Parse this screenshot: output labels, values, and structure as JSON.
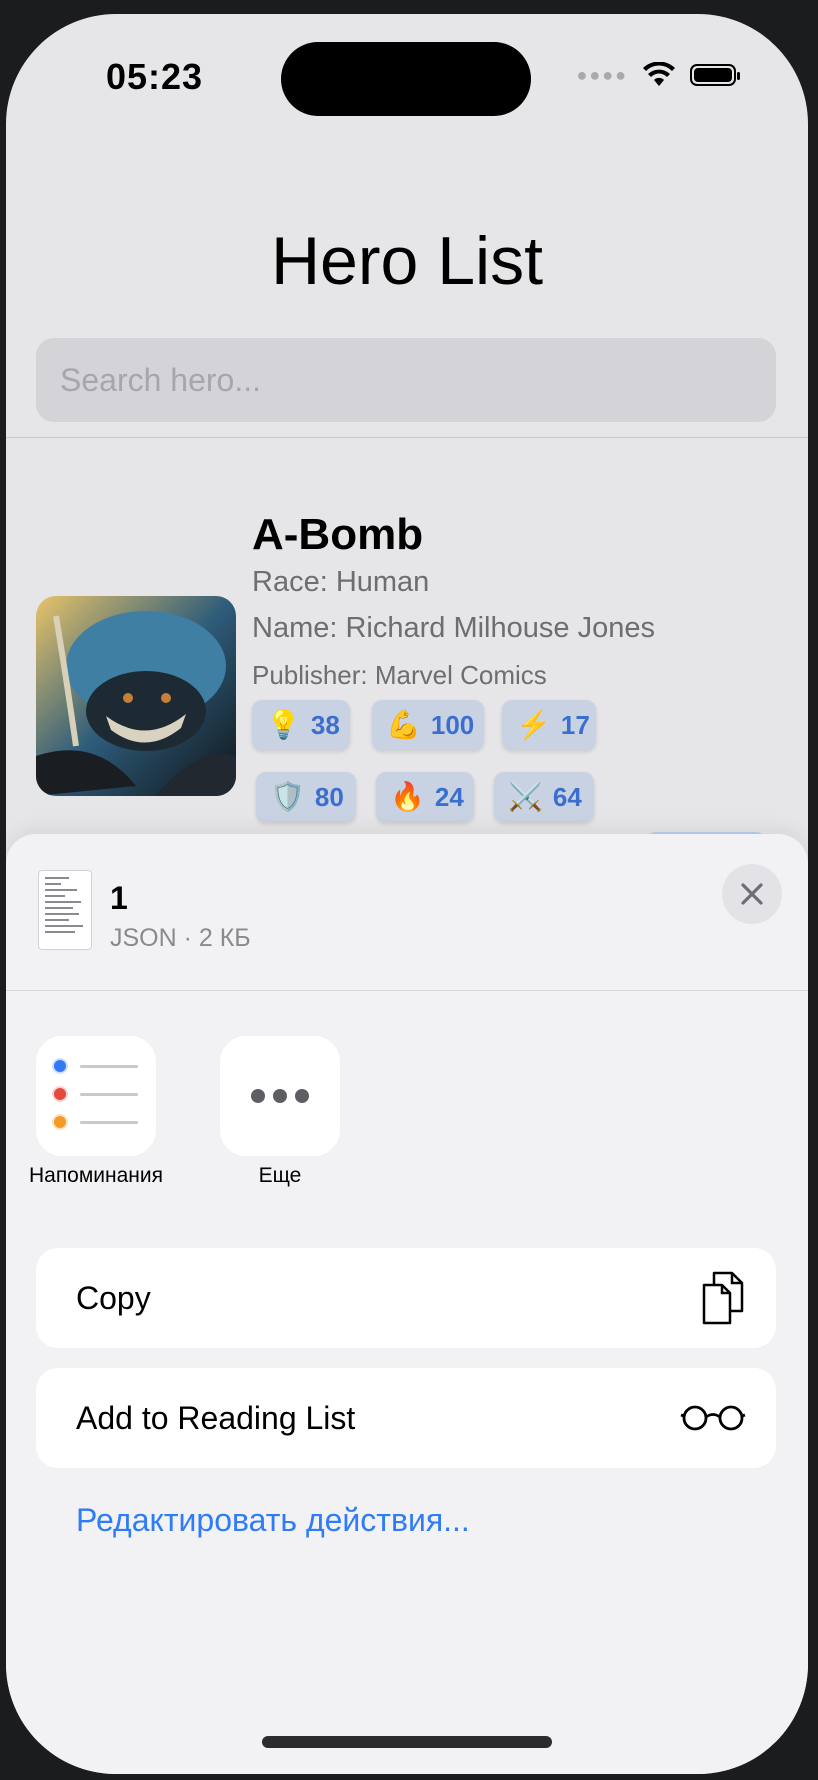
{
  "status": {
    "time": "05:23"
  },
  "header": {
    "title": "Hero List"
  },
  "search": {
    "placeholder": "Search hero..."
  },
  "hero": {
    "name": "A-Bomb",
    "race": "Race: Human",
    "full_name": "Name: Richard Milhouse Jones",
    "publisher": "Publisher: Marvel Comics",
    "stats": [
      {
        "icon": "lightbulb-icon",
        "value": "38"
      },
      {
        "icon": "flexed-biceps-icon",
        "value": "100"
      },
      {
        "icon": "lightning-icon",
        "value": "17"
      },
      {
        "icon": "shield-icon",
        "value": "80"
      },
      {
        "icon": "fire-icon",
        "value": "24"
      },
      {
        "icon": "crossed-swords-icon",
        "value": "64"
      }
    ]
  },
  "share_sheet": {
    "file_name": "1",
    "file_info": "JSON · 2 КБ",
    "apps": [
      {
        "label": "Напоминания",
        "icon": "reminders-icon"
      },
      {
        "label": "Еще",
        "icon": "more-icon"
      }
    ],
    "actions": [
      {
        "label": "Copy",
        "icon": "copy-icon"
      },
      {
        "label": "Add to Reading List",
        "icon": "glasses-icon"
      }
    ],
    "edit_actions": "Редактировать действия..."
  },
  "colors": {
    "accent": "#2f7cf6",
    "stat_value": "#3a6fd0",
    "stat_bg": "#c8d2e3"
  }
}
